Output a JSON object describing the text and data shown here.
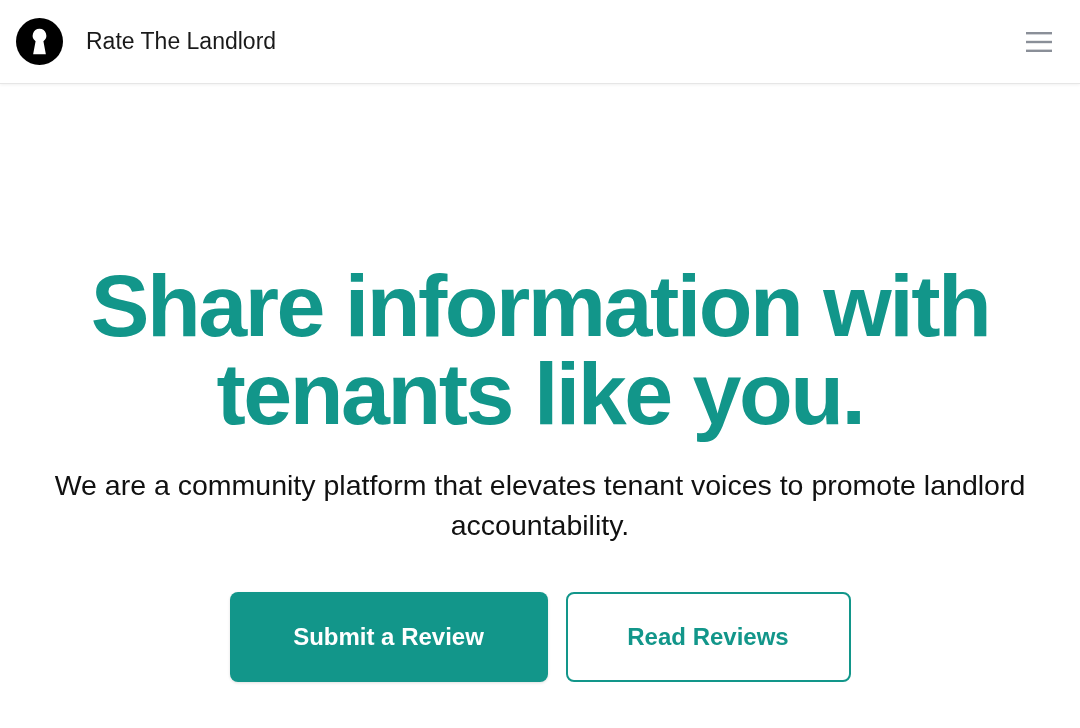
{
  "header": {
    "title": "Rate The Landlord"
  },
  "hero": {
    "headline": "Share information with tenants like you.",
    "description": "We are a community platform that elevates tenant voices to promote landlord accountability.",
    "buttons": [
      {
        "label": "Submit a Review",
        "kind": "primary"
      },
      {
        "label": "Read Reviews",
        "kind": "outline"
      }
    ]
  }
}
